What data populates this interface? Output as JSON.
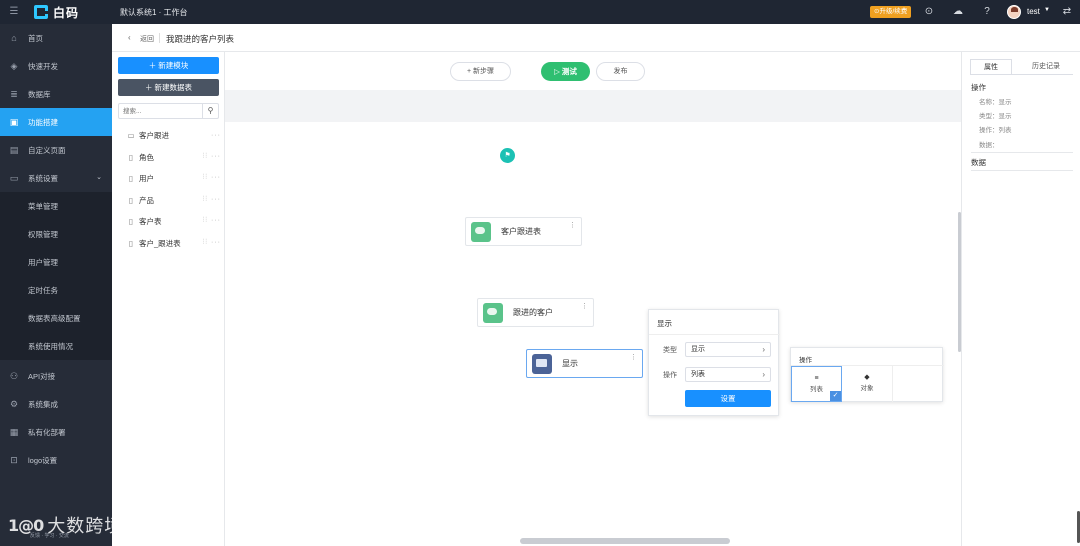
{
  "topbar": {
    "logo_text": "白码",
    "system_title": "默认系统1 · 工作台",
    "upgrade_label": "⊙升级/续费",
    "user_name": "test",
    "icons": [
      "menu-icon",
      "play-icon",
      "cloud-icon",
      "help-icon",
      "swap-icon"
    ]
  },
  "sidebar": {
    "items": [
      {
        "label": "首页",
        "icon": "home-icon"
      },
      {
        "label": "快速开发",
        "icon": "cube-icon"
      },
      {
        "label": "数据库",
        "icon": "database-icon"
      },
      {
        "label": "功能搭建",
        "icon": "build-icon"
      },
      {
        "label": "自定义页面",
        "icon": "page-icon"
      },
      {
        "label": "系统设置",
        "icon": "settings-icon"
      },
      {
        "label": "API对接",
        "icon": "api-icon"
      },
      {
        "label": "系统集成",
        "icon": "integration-icon"
      },
      {
        "label": "私有化部署",
        "icon": "deploy-icon"
      },
      {
        "label": "logo设置",
        "icon": "logo-icon"
      }
    ],
    "sub_items": [
      "菜单管理",
      "权限管理",
      "用户管理",
      "定时任务",
      "数据表高级配置",
      "系统使用情况"
    ],
    "active": "功能搭建",
    "watermark": {
      "logo": "1@0",
      "text": "大数跨境",
      "sub": "反馈 · 学习 · 交流"
    }
  },
  "breadcrumb": {
    "back_label": "返回",
    "title": "我跟进的客户列表"
  },
  "left_panel": {
    "new_module_label": "＋  新建模块",
    "new_table_label": "＋  新建数据表",
    "search_placeholder": "搜索...",
    "tree": [
      {
        "label": "客户跟进",
        "icon": "folder-icon",
        "ops": "···"
      },
      {
        "label": "角色",
        "icon": "file-icon",
        "ops": "⫶⫶ ···"
      },
      {
        "label": "用户",
        "icon": "file-icon",
        "ops": "⫶⫶ ···"
      },
      {
        "label": "产品",
        "icon": "file-icon",
        "ops": "⫶⫶ ···"
      },
      {
        "label": "客户表",
        "icon": "file-icon",
        "ops": "⫶⫶ ···"
      },
      {
        "label": "客户_跟进表",
        "icon": "file-icon",
        "ops": "⫶⫶ ···"
      }
    ]
  },
  "canvas": {
    "add_step_label": "+ 新步骤",
    "test_label": "▷ 测试",
    "publish_label": "发布",
    "nodes": [
      {
        "label": "客户跟进表",
        "icon": "table-query-icon"
      },
      {
        "label": "跟进的客户",
        "icon": "table-link-icon"
      },
      {
        "label": "显示",
        "icon": "display-icon"
      }
    ],
    "props_popup": {
      "title": "显示",
      "type_label": "类型",
      "type_value": "显示",
      "op_label": "操作",
      "op_value": "列表",
      "confirm_label": "设置"
    },
    "op_popup": {
      "title": "操作",
      "options": [
        {
          "label": "列表",
          "icon": "list-icon",
          "selected": true
        },
        {
          "label": "对象",
          "icon": "object-icon",
          "selected": false
        }
      ]
    }
  },
  "right_panel": {
    "tabs": [
      "属性",
      "历史记录"
    ],
    "active_tab": "属性",
    "section_op": "操作",
    "kv": [
      {
        "key": "名称",
        "value": "显示"
      },
      {
        "key": "类型",
        "value": "显示"
      },
      {
        "key": "操作",
        "value": "列表"
      },
      {
        "key": "数据",
        "value": ""
      }
    ],
    "section_data": "数据"
  },
  "colors": {
    "topbar_bg": "#1f2633",
    "sidebar_bg": "#262c38",
    "accent_blue": "#1890ff",
    "active_nav": "#24a2f2",
    "test_green": "#2fbf71",
    "node_green": "#5ac38a",
    "start_teal": "#1cc1b4"
  }
}
